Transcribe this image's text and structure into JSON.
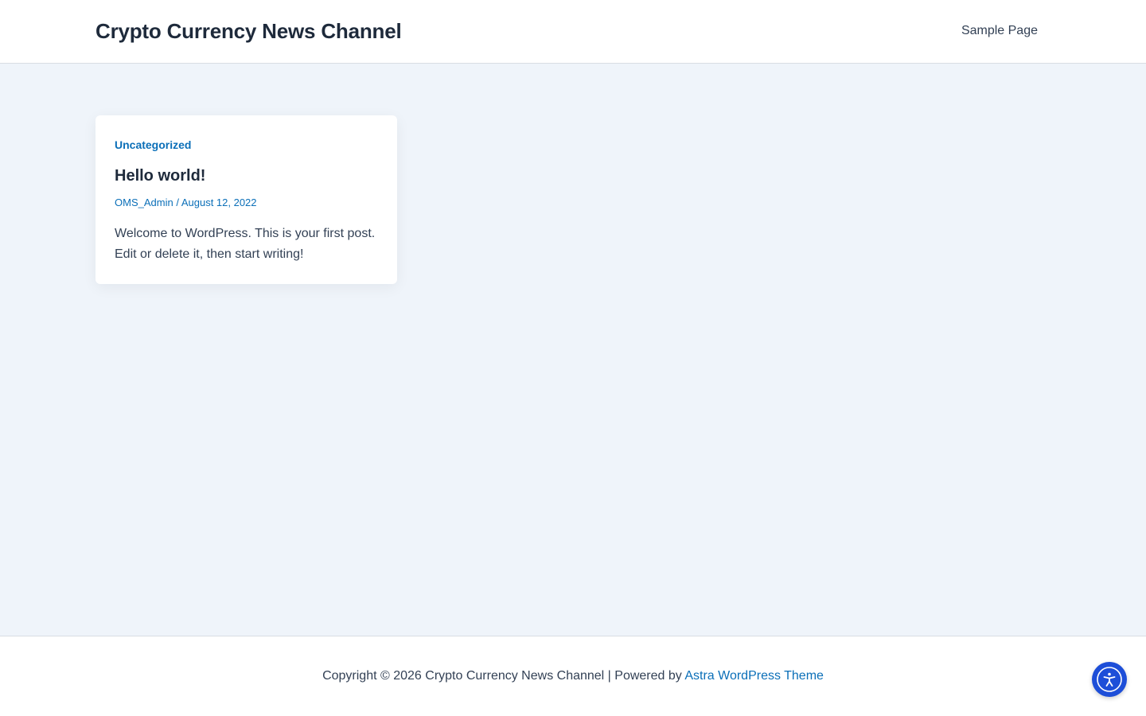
{
  "header": {
    "site_title": "Crypto Currency News Channel",
    "nav": [
      {
        "label": "Sample Page"
      }
    ]
  },
  "post": {
    "category": "Uncategorized",
    "title": "Hello world!",
    "author": "OMS_Admin",
    "separator": " / ",
    "date": "August 12, 2022",
    "excerpt": "Welcome to WordPress. This is your first post. Edit or delete it, then start writing!"
  },
  "footer": {
    "copyright": "Copyright © 2026 Crypto Currency News Channel | Powered by ",
    "theme_link": "Astra WordPress Theme"
  },
  "accessibility": {
    "icon": "accessibility-icon"
  },
  "colors": {
    "accent": "#0b6fb8",
    "page_bg": "#eff4fa",
    "a11y_button": "#1d4ed8"
  }
}
